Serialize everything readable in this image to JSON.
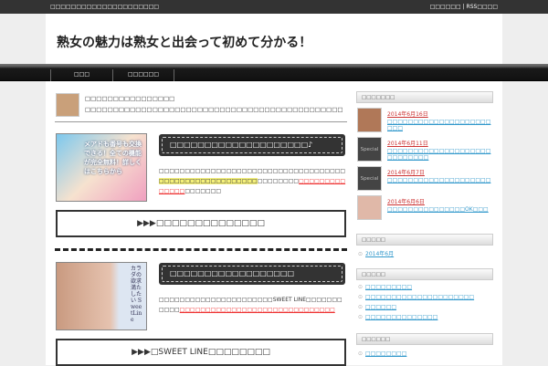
{
  "topbar": {
    "tagline": "□□□□□□□□□□□□□□□□□□□□□",
    "links": "□□□□□□ | RSS□□□□"
  },
  "header": {
    "title": "熟女の魅力は熟女と出会って初めて分かる！"
  },
  "nav": [
    {
      "label": "□□□"
    },
    {
      "label": "□□□□□□"
    }
  ],
  "intro": {
    "title": "□□□□□□□□□□□□□□□□",
    "desc": "□□□□□□□□□□□□□□□□□□□□□□□□□□□□□□□□□□□□□□□□□□□□□□"
  },
  "section1": {
    "banner_alt": "メアドも番号も交換できる！全ての機能が完全無料！詳しくはこちらから",
    "heading": "□□□□□□□□□□□□□□□□□□□□♪",
    "text_a": "□□□□□□□□□□□□□□□□□□□□□□□□□□□□□□□□□□□□",
    "text_hl": "□□□□□□□□□□□□□□□□□□□",
    "text_b": "□□□□□□□□",
    "text_red": "□□□□□□□□□□□□□□",
    "text_c": "□□□□□□□",
    "cta": "▶▶▶□□□□□□□□□□□□□□"
  },
  "section2": {
    "banner_alt": "カラダの欲求満たしたい SweetLine",
    "heading": "□□□□□□□□□□□□□□□□□□",
    "text_a": "□□□□□□□□□□□□□□□□□□□□□□SWEET LINE□□□□□□□□□□□",
    "text_red": "□□□□□□□□□□□□□□□□□□□□□□□□□□□□□□",
    "cta": "▶▶▶□SWEET LINE□□□□□□□□"
  },
  "sidebar": {
    "recent_title": "□□□□□□□",
    "recent": [
      {
        "date": "2014年6月16日",
        "title": "□□□□□□□□□□□□□□□□□□□□□□□"
      },
      {
        "date": "2014年6月11日",
        "title": "□□□□□□□□□□□□□□□□□□□□□□□□□□□□"
      },
      {
        "date": "2014年6月7日",
        "title": "□□□□□□□□□□□□□□□□□□□□"
      },
      {
        "date": "2014年6月6日",
        "title": "□□□□□□□□□□□□□□□OK□□□"
      }
    ],
    "archive_title": "□□□□□",
    "archives": [
      "2014年6月"
    ],
    "category_title": "□□□□□",
    "categories": [
      "□□□□□□□□□",
      "□□□□□□□□□□□□□□□□□□□□□",
      "□□□□□□",
      "□□□□□□□□□□□□□□"
    ],
    "meta_title": "□□□□□□",
    "meta": [
      "□□□□□□□□"
    ],
    "special_label": "Special"
  }
}
